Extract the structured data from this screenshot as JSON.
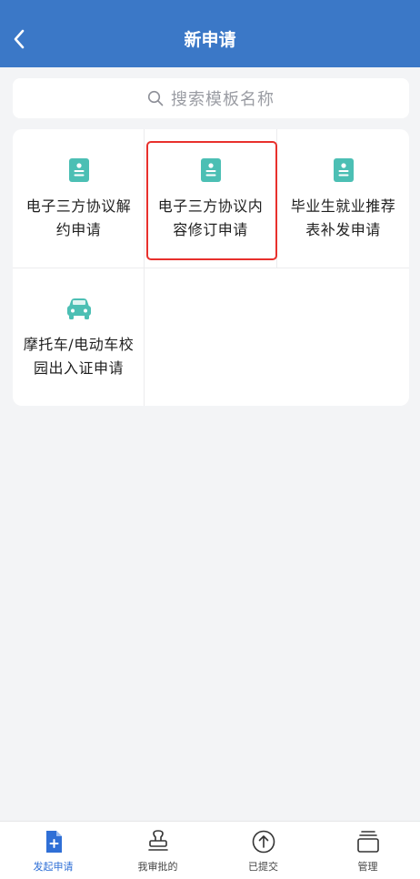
{
  "header": {
    "title": "新申请"
  },
  "search": {
    "placeholder": "搜索模板名称"
  },
  "templates": [
    {
      "label": "电子三方协议解约申请",
      "icon": "document-icon"
    },
    {
      "label": "电子三方协议内容修订申请",
      "icon": "document-icon"
    },
    {
      "label": "毕业生就业推荐表补发申请",
      "icon": "document-icon"
    },
    {
      "label": "摩托车/电动车校园出入证申请",
      "icon": "car-icon"
    }
  ],
  "tabs": [
    {
      "label": "发起申请",
      "icon": "add-document-icon",
      "active": true
    },
    {
      "label": "我审批的",
      "icon": "stamp-icon"
    },
    {
      "label": "已提交",
      "icon": "upload-circle-icon"
    },
    {
      "label": "管理",
      "icon": "stack-icon"
    }
  ],
  "colors": {
    "header": "#3b78c7",
    "accent": "#2f6fd6",
    "icon_teal": "#4cbfb4",
    "highlight": "#e8302c"
  }
}
